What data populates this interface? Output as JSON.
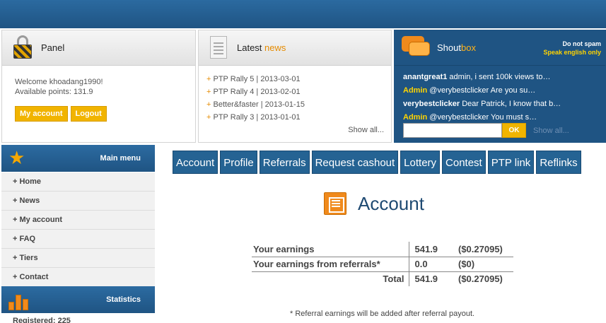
{
  "panel": {
    "title": "Panel",
    "welcome": "Welcome khoadang1990!",
    "points": "Available points: 131.9",
    "my_account_label": "My account",
    "logout_label": "Logout"
  },
  "news": {
    "title_main": "Latest",
    "title_accent": "news",
    "items": [
      "PTP Rally 5 | 2013-03-01",
      "PTP Rally 4 | 2013-02-01",
      "Better&faster | 2013-01-15",
      "PTP Rally 3 | 2013-01-01"
    ],
    "show_all": "Show all..."
  },
  "shoutbox": {
    "title_main": "Shout",
    "title_accent": "box",
    "note_line1": "Do not spam",
    "note_line2": "Speak english only",
    "messages": [
      {
        "user": "anantgreat1",
        "text": "admin, i sent 100k views to…",
        "admin": false
      },
      {
        "user": "Admin",
        "text": "@verybestclicker Are you su…",
        "admin": true
      },
      {
        "user": "verybestclicker",
        "text": "Dear Patrick, I know that b…",
        "admin": false
      },
      {
        "user": "Admin",
        "text": "@verybestclicker You must s…",
        "admin": true
      }
    ],
    "input_value": "",
    "ok_label": "OK",
    "show_all": "Show all..."
  },
  "main_menu": {
    "title": "Main menu",
    "items": [
      "+ Home",
      "+ News",
      "+ My account",
      "+ FAQ",
      "+ Tiers",
      "+ Contact"
    ]
  },
  "statistics": {
    "title": "Statistics",
    "partial_row": "Registered:   225"
  },
  "tabs": [
    "Account",
    "Profile",
    "Referrals",
    "Request cashout",
    "Lottery",
    "Contest",
    "PTP link",
    "Reflinks"
  ],
  "account": {
    "title": "Account",
    "rows": [
      {
        "label": "Your earnings",
        "value": "541.9",
        "usd": "($0.27095)"
      },
      {
        "label": "Your earnings from referrals*",
        "value": "0.0",
        "usd": "($0)"
      },
      {
        "label": "Total",
        "value": "541.9",
        "usd": "($0.27095)"
      }
    ],
    "note": "* Referral earnings will be added after referral payout."
  },
  "colors": {
    "brand_blue": "#1f5483",
    "accent_orange": "#e58b00",
    "button_yellow": "#f1b400"
  }
}
